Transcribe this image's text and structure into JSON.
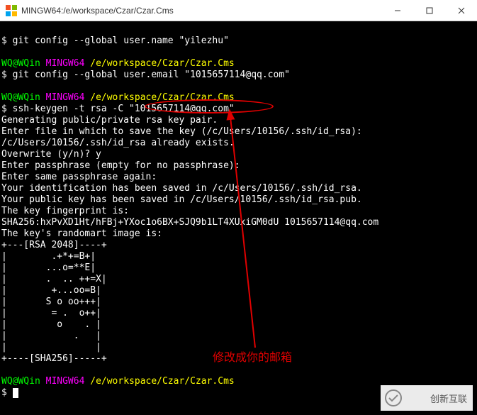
{
  "window": {
    "title": "MINGW64:/e/workspace/Czar/Czar.Cms"
  },
  "prompt": {
    "user_host": "WQ@WQin",
    "env": "MINGW64",
    "path": "/e/workspace/Czar/Czar.Cms",
    "symbol": "$"
  },
  "commands": {
    "cfg_name": "git config --global user.name \"yilezhu\"",
    "cfg_email": "git config --global user.email \"1015657114@qq.com\"",
    "ssh_prefix": "ssh-keygen -t rsa -C",
    "ssh_email": "\"1015657114@qq.com\""
  },
  "output": {
    "l1": "Generating public/private rsa key pair.",
    "l2": "Enter file in which to save the key (/c/Users/10156/.ssh/id_rsa):",
    "l3": "/c/Users/10156/.ssh/id_rsa already exists.",
    "l4": "Overwrite (y/n)? y",
    "l5": "Enter passphrase (empty for no passphrase):",
    "l6": "Enter same passphrase again:",
    "l7": "Your identification has been saved in /c/Users/10156/.ssh/id_rsa.",
    "l8": "Your public key has been saved in /c/Users/10156/.ssh/id_rsa.pub.",
    "l9": "The key fingerprint is:",
    "l10": "SHA256:hxPvXD1Ht/hFBj+YXoc1o6BX+SJQ9b1LT4XUxiGM0dU 1015657114@qq.com",
    "l11": "The key's randomart image is:",
    "art0": "+---[RSA 2048]----+",
    "art1": "|        .+*+=B+|",
    "art2": "|       ...o=**E|",
    "art3": "|       .  .. ++=X|",
    "art4": "|        +...oo=B|",
    "art5": "|       S o oo+++|",
    "art6": "|        = .  o++|",
    "art7": "|         o    . |",
    "art8": "|            .   |",
    "art9": "|                |",
    "art10": "+----[SHA256]-----+"
  },
  "annotation": {
    "text": "修改成你的邮箱"
  },
  "watermark": {
    "text": "创新互联"
  }
}
